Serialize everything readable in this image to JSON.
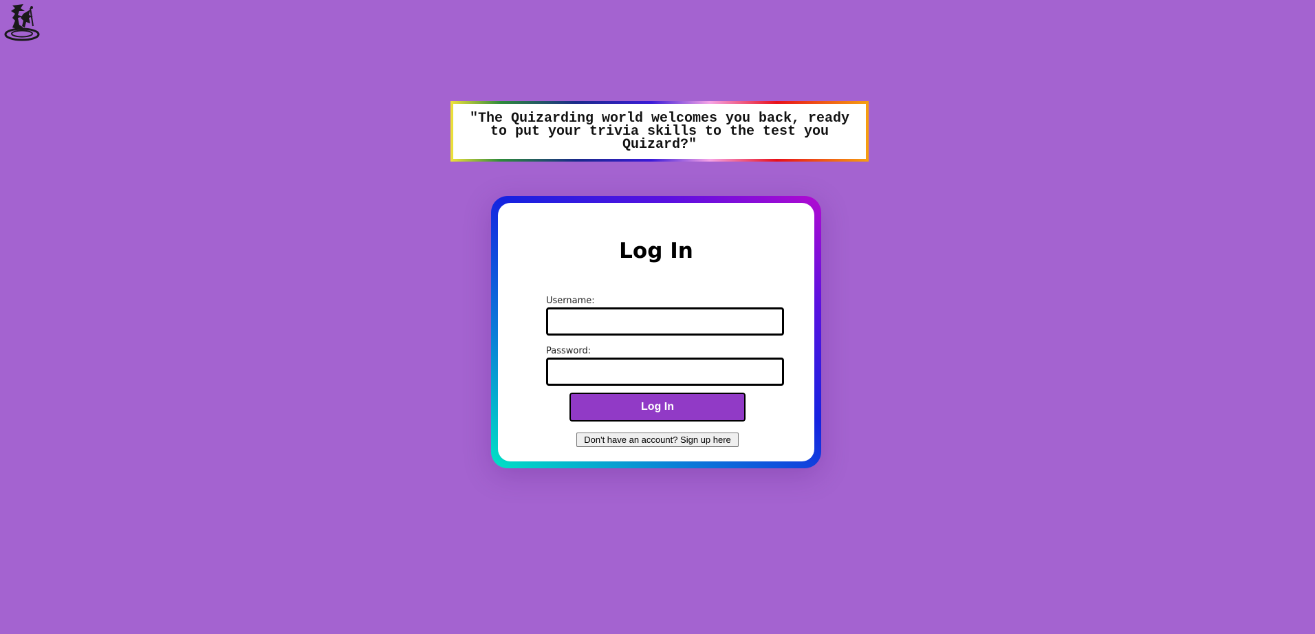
{
  "logo": {
    "icon": "wizard-hat-icon",
    "color": "#1a1a1a"
  },
  "banner": {
    "text": "\"The Quizarding world welcomes you back, ready to put your trivia skills to the test you Quizard?\""
  },
  "login": {
    "title": "Log In",
    "username_label": "Username:",
    "username_value": "",
    "password_label": "Password:",
    "password_value": "",
    "submit_label": "Log In",
    "signup_label": "Don't have an account? Sign up here"
  },
  "colors": {
    "background": "#a463d0",
    "button": "#913ac6",
    "card": "#ffffff"
  }
}
